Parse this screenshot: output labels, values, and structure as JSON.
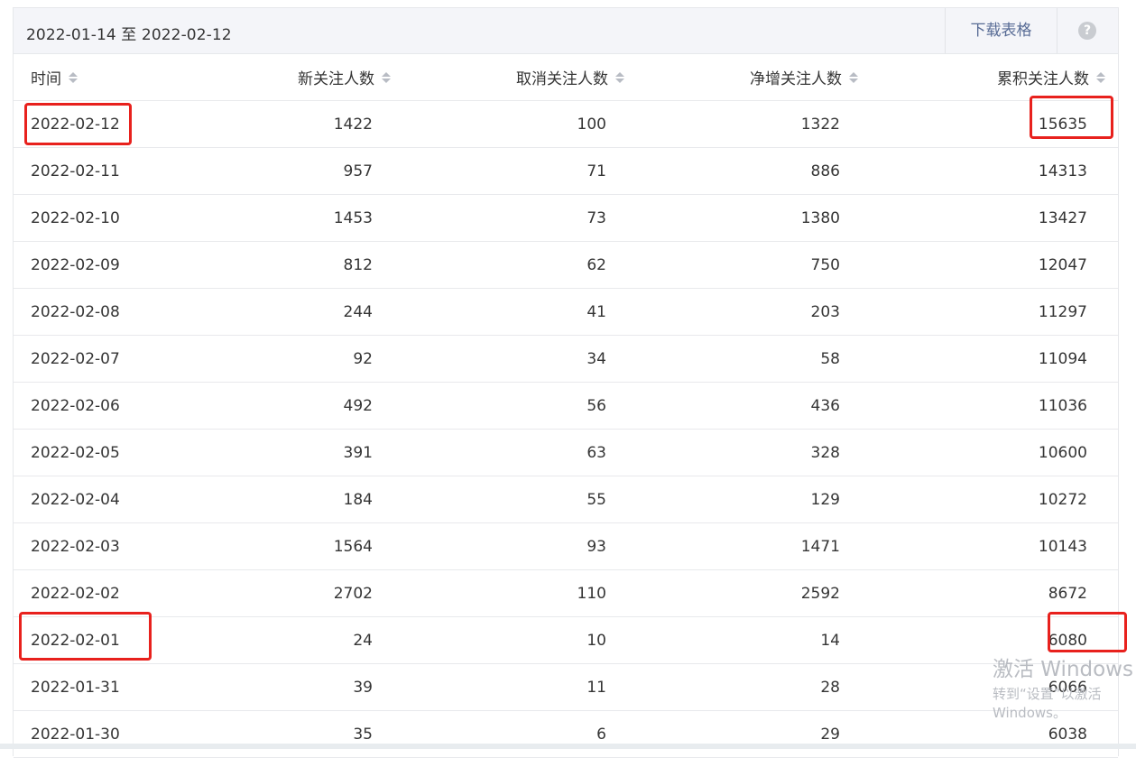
{
  "header": {
    "date_range": "2022-01-14 至 2022-02-12",
    "download_label": "下载表格",
    "help_glyph": "?"
  },
  "table": {
    "columns": [
      "时间",
      "新关注人数",
      "取消关注人数",
      "净增关注人数",
      "累积关注人数"
    ],
    "rows": [
      [
        "2022-02-12",
        "1422",
        "100",
        "1322",
        "15635"
      ],
      [
        "2022-02-11",
        "957",
        "71",
        "886",
        "14313"
      ],
      [
        "2022-02-10",
        "1453",
        "73",
        "1380",
        "13427"
      ],
      [
        "2022-02-09",
        "812",
        "62",
        "750",
        "12047"
      ],
      [
        "2022-02-08",
        "244",
        "41",
        "203",
        "11297"
      ],
      [
        "2022-02-07",
        "92",
        "34",
        "58",
        "11094"
      ],
      [
        "2022-02-06",
        "492",
        "56",
        "436",
        "11036"
      ],
      [
        "2022-02-05",
        "391",
        "63",
        "328",
        "10600"
      ],
      [
        "2022-02-04",
        "184",
        "55",
        "129",
        "10272"
      ],
      [
        "2022-02-03",
        "1564",
        "93",
        "1471",
        "10143"
      ],
      [
        "2022-02-02",
        "2702",
        "110",
        "2592",
        "8672"
      ],
      [
        "2022-02-01",
        "24",
        "10",
        "14",
        "6080"
      ],
      [
        "2022-01-31",
        "39",
        "11",
        "28",
        "6066"
      ],
      [
        "2022-01-30",
        "35",
        "6",
        "29",
        "6038"
      ]
    ]
  },
  "watermark": {
    "line1": "激活 Windows",
    "line2": "转到“设置”以激活 Windows。"
  },
  "colors": {
    "highlight": "#e8211d",
    "link": "#576b95",
    "header_bg": "#f4f5f9"
  },
  "icons": [
    "sort-icon",
    "help-icon"
  ]
}
